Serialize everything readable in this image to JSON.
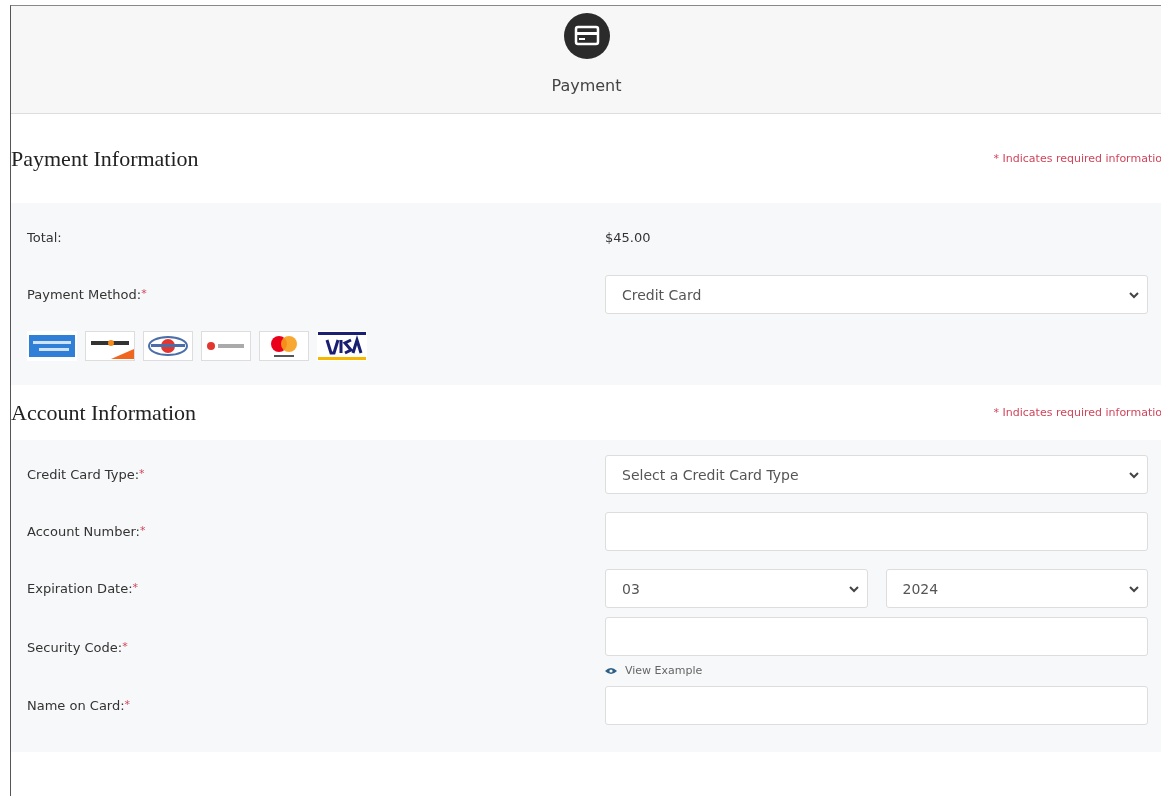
{
  "header": {
    "title": "Payment"
  },
  "sections": [
    {
      "title": "Payment Information",
      "note": "* Indicates required informatio",
      "rows": [
        {
          "kind": "text",
          "label": "Total:",
          "value": "$45.00"
        },
        {
          "kind": "select",
          "label": "Payment Method:",
          "mark": "*",
          "value": "Credit Card"
        },
        {
          "kind": "cards",
          "cards": [
            {
              "kind": "amex"
            },
            {
              "kind": "discover"
            },
            {
              "kind": "diners"
            },
            {
              "kind": "jcb"
            },
            {
              "kind": "mastercard"
            },
            {
              "kind": "visa"
            }
          ]
        }
      ]
    },
    {
      "title": "Account Information",
      "note": "* Indicates required informatio",
      "rows": [
        {
          "kind": "select",
          "label": "Credit Card Type:",
          "mark": "*",
          "value": "Select a Credit Card Type"
        },
        {
          "kind": "input",
          "label": "Account Number:",
          "mark": "*"
        },
        {
          "kind": "pair",
          "label": "Expiration Date:",
          "mark": "*",
          "values": [
            "03",
            "2024"
          ]
        },
        {
          "kind": "input",
          "label": "Security Code:",
          "mark": "*",
          "link": "View Example"
        },
        {
          "kind": "input",
          "label": "Name on Card:",
          "mark": "*"
        }
      ]
    }
  ]
}
